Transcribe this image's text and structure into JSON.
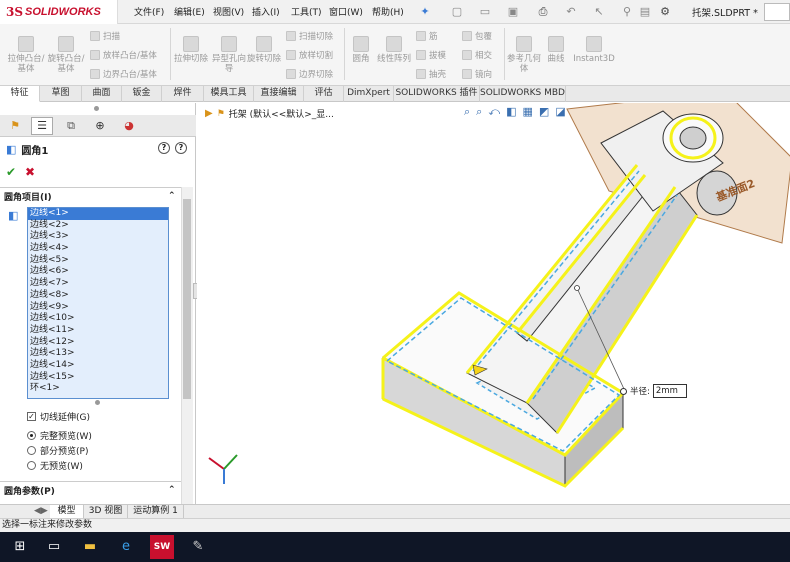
{
  "app": {
    "brand": "SOLIDWORKS",
    "brand_mark": "3S",
    "filename": "托架.SLDPRT *"
  },
  "menu": [
    "文件(F)",
    "编辑(E)",
    "视图(V)",
    "插入(I)",
    "工具(T)",
    "窗口(W)",
    "帮助(H)"
  ],
  "ribbon": {
    "big": [
      "拉伸凸台/基体",
      "旋转凸台/基体",
      "拉伸切除",
      "异型孔向导",
      "旋转切除",
      "圆角",
      "线性阵列",
      "参考几何体",
      "曲线",
      "Instant3D"
    ],
    "small": [
      "扫描",
      "放样凸台/基体",
      "边界凸台/基体",
      "扫描切除",
      "放样切割",
      "边界切除",
      "筋",
      "拔模",
      "抽壳",
      "包覆",
      "相交",
      "镜向"
    ]
  },
  "tabs": [
    "特征",
    "草图",
    "曲面",
    "钣金",
    "焊件",
    "模具工具",
    "直接编辑",
    "评估",
    "DimXpert",
    "SOLIDWORKS 插件",
    "SOLIDWORKS MBD"
  ],
  "active_tab": "特征",
  "property_manager": {
    "title": "圆角1",
    "section_items": "圆角项目(I)",
    "edges": [
      "边线<1>",
      "边线<2>",
      "边线<3>",
      "边线<4>",
      "边线<5>",
      "边线<6>",
      "边线<7>",
      "边线<8>",
      "边线<9>",
      "边线<10>",
      "边线<11>",
      "边线<12>",
      "边线<13>",
      "边线<14>",
      "边线<15>",
      "环<1>"
    ],
    "tangent_propagation": "切线延伸(G)",
    "tangent_checked": true,
    "preview_options": [
      "完整预览(W)",
      "部分预览(P)",
      "无预览(W)"
    ],
    "preview_selected": 0,
    "section_params": "圆角参数(P)"
  },
  "viewport": {
    "tree_label": "托架 (默认<<默认>_显...",
    "plane_label": "基准面2",
    "radius_label": "半径:",
    "radius_value": "2mm"
  },
  "bottom_tabs": [
    "模型",
    "3D 视图",
    "运动算例 1"
  ],
  "status": "选择一标注来修改参数",
  "colors": {
    "accent": "#3a7bd5",
    "edge_highlight": "#f5f21a",
    "edge_blue": "#4aa8e0",
    "brand": "#c8102e"
  }
}
